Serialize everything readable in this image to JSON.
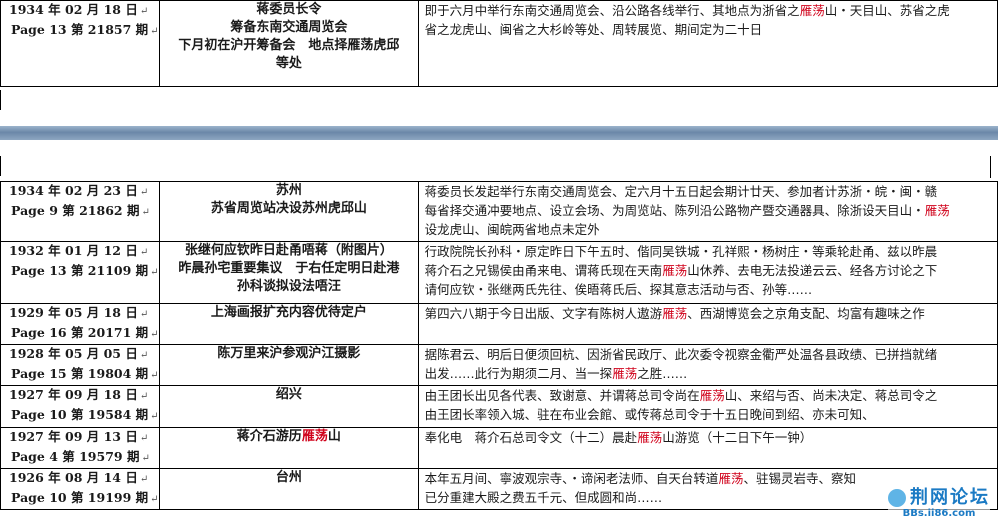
{
  "rows": [
    {
      "date": "1934 年 02 月 18 日",
      "page": "Page 13  第 21857 期",
      "title": [
        "蒋委员长令",
        "筹备东南交通周览会",
        "下月初在沪开筹备会　地点择雁荡虎邱",
        "等处"
      ],
      "content": [
        [
          "即于六月中举行东南交通周览会、沿公路各线举行、其地点为浙省之",
          {
            "h": "雁荡"
          },
          "山・天目山、苏省之虎"
        ],
        [
          "省之龙虎山、闽省之大杉岭等处、周转展览、期间定为二十日"
        ]
      ]
    },
    {
      "date": "1934 年 02 月 23 日",
      "page": "Page 9  第 21862 期",
      "title": [
        "苏州",
        "苏省周览站决设苏州虎邱山"
      ],
      "content": [
        [
          "蒋委员长发起举行东南交通周览会、定六月十五日起会期计廿天、参加者计苏浙・皖・闽・赣"
        ],
        [
          "每省择交通冲要地点、设立会场、为周览站、陈列沿公路物产暨交通器具、除浙设天目山・",
          {
            "h": "雁荡"
          }
        ],
        [
          "设龙虎山、闽皖两省地点未定外"
        ]
      ]
    },
    {
      "date": "1932 年 01 月 12 日",
      "page": "Page 13  第 21109 期",
      "title": [
        "张继何应钦昨日赴甬唔蒋（附图片）",
        "昨晨孙宅重要集议　于右任定明日赴港",
        "孙科谈拟设法唔汪"
      ],
      "content": [
        [
          "行政院院长孙科・原定昨日下午五时、偕同吴铁城・孔祥熙・杨树庄・等乘轮赴甬、兹以昨晨"
        ],
        [
          "蒋介石之兄锡侯由甬来电、谓蒋氏现在天南",
          {
            "h": "雁荡"
          },
          "山休养、去电无法投递云云、经各方讨论之下"
        ],
        [
          "请何应钦・张继两氏先往、俟晤蒋氏后、探其意志活动与否、孙等……"
        ]
      ]
    },
    {
      "date": "1929 年 05 月 18 日",
      "page": "Page 16  第 20171 期",
      "title": [
        "上海画报扩充内容优待定户"
      ],
      "content": [
        [
          "第四六八期于今日出版、文字有陈树人遨游",
          {
            "h": "雁荡"
          },
          "、西湖博览会之京角支配、均富有趣味之作"
        ]
      ]
    },
    {
      "date": "1928 年 05 月 05 日",
      "page": "Page 15  第 19804 期",
      "title": [
        "陈万里来沪参观沪江摄影"
      ],
      "content": [
        [
          "据陈君云、明后日便须回杭、因浙省民政厅、此次委令视察金衢严处温各县政绩、已拼挡就绪"
        ],
        [
          "出发……此行为期须二月、当一探",
          {
            "h": "雁荡"
          },
          "之胜……"
        ]
      ]
    },
    {
      "date": "1927 年 09 月 18 日",
      "page": "Page 10  第 19584 期",
      "title": [
        "绍兴"
      ],
      "content": [
        [
          "由王团长出见各代表、致谢意、并谓蒋总司令尚在",
          {
            "h": "雁荡"
          },
          "山、来绍与否、尚未决定、蒋总司令之"
        ],
        [
          "由王团长率领入城、驻在布业会館、或传蒋总司令于十五日晚间到绍、亦未可知、"
        ]
      ]
    },
    {
      "date": "1927 年 09 月 13 日",
      "page": "Page 4  第 19579 期",
      "title": [
        "蒋介石游历",
        {
          "h": "雁荡"
        },
        "山"
      ],
      "content": [
        [
          "奉化电　蒋介石总司令文（十二）晨赴",
          {
            "h": "雁荡"
          },
          "山游览（十二日下午一钟）"
        ]
      ]
    },
    {
      "date": "1926 年 08 月 14 日",
      "page": "Page 10  第 19199 期",
      "title": [
        "台州"
      ],
      "content": [
        [
          "本年五月间、寧波观宗寺、・谛闲老法师、自天台转道",
          {
            "h": "雁荡"
          },
          "、驻锡灵岩寺、察知"
        ],
        [
          "已分重建大殿之费五千元、但成圆和尚……"
        ]
      ]
    }
  ],
  "return_mark": "↵",
  "watermark": {
    "title": "荆网论坛",
    "url": "BBs.ii86.com"
  },
  "colors": {
    "highlight": "#d0021b",
    "bar": "#6b87a8",
    "watermark": "#1b7ac4"
  }
}
